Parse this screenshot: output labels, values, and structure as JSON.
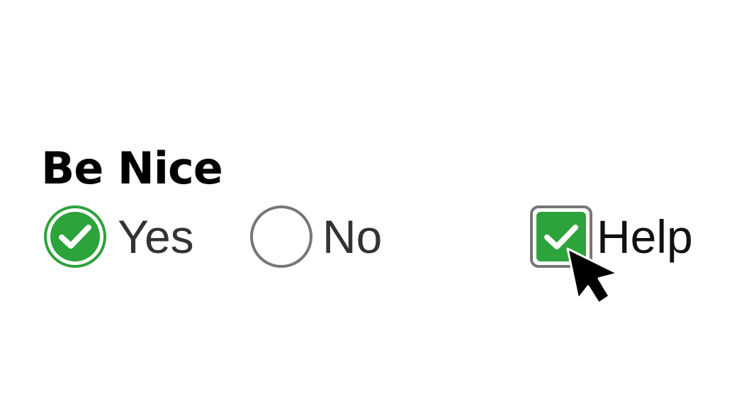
{
  "group": {
    "title": "Be Nice"
  },
  "options": {
    "yes": {
      "label": "Yes",
      "checked": true
    },
    "no": {
      "label": "No",
      "checked": false
    },
    "help": {
      "label": "Help",
      "checked": true
    }
  },
  "colors": {
    "accent": "#2ca33b",
    "border_gray": "#767676",
    "text": "#333333",
    "title": "#000000",
    "cursor": "#000000"
  },
  "icons": {
    "check": "check-icon",
    "cursor": "mouse-pointer-icon"
  }
}
